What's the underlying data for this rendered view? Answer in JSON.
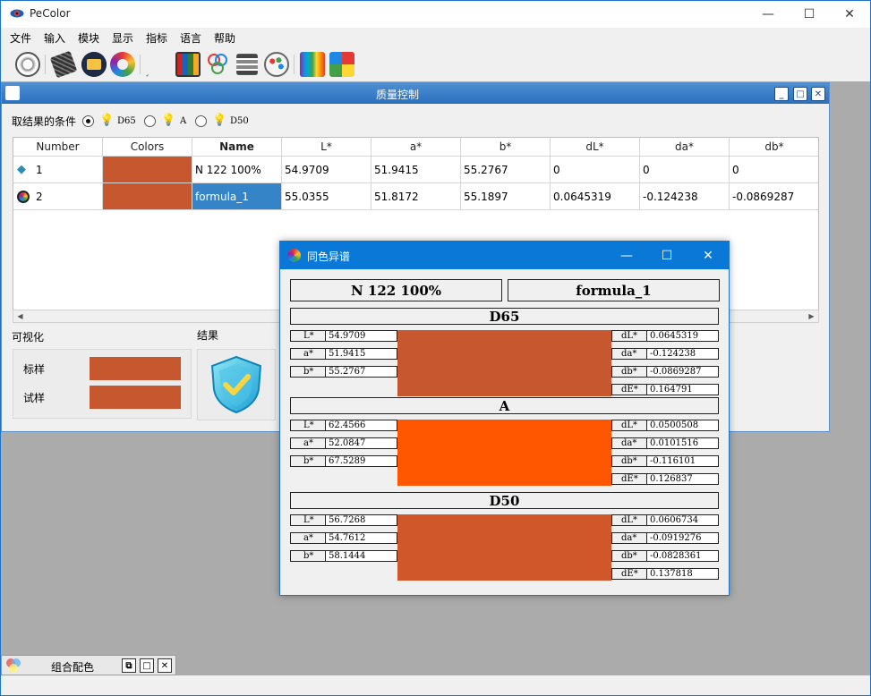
{
  "app": {
    "title": "PeColor"
  },
  "menu": [
    "文件",
    "输入",
    "模块",
    "显示",
    "指标",
    "语言",
    "帮助"
  ],
  "toolbar_icons": [
    "settings-gear-icon",
    "ruler-icon",
    "folder-icon",
    "color-ring-icon",
    "fan-deck-icon",
    "swatch-grid-icon",
    "rgb-circles-icon",
    "lab-report-icon",
    "palette-icon",
    "spectrum-icon",
    "color-square-icon"
  ],
  "qc": {
    "title": "质量控制",
    "condition_label": "取结果的条件",
    "illuminants": [
      {
        "label": "D65",
        "selected": true
      },
      {
        "label": "A",
        "selected": false
      },
      {
        "label": "D50",
        "selected": false
      }
    ],
    "columns": [
      "Number",
      "Colors",
      "Name",
      "L*",
      "a*",
      "b*",
      "dL*",
      "da*",
      "db*"
    ],
    "rows": [
      {
        "icon": "diamond-icon",
        "number": "1",
        "name": "N 122 100%",
        "L": "54.9709",
        "a": "51.9415",
        "b": "55.2767",
        "dL": "0",
        "da": "0",
        "db": "0",
        "color": "#c6572e"
      },
      {
        "icon": "sample-ball-icon",
        "number": "2",
        "name": "formula_1",
        "L": "55.0355",
        "a": "51.8172",
        "b": "55.1897",
        "dL": "0.0645319",
        "da": "-0.124238",
        "db": "-0.0869287",
        "color": "#c6572e"
      }
    ],
    "vis_title": "可视化",
    "vis_std": "标样",
    "vis_trial": "试样",
    "result_title": "结果"
  },
  "dialog": {
    "title": "同色异谱",
    "std_name": "N 122 100%",
    "trial_name": "formula_1",
    "sections": [
      {
        "name": "D65",
        "color": "#c6572e",
        "left": [
          [
            "L*",
            "54.9709"
          ],
          [
            "a*",
            "51.9415"
          ],
          [
            "b*",
            "55.2767"
          ]
        ],
        "right": [
          [
            "dL*",
            "0.0645319"
          ],
          [
            "da*",
            "-0.124238"
          ],
          [
            "db*",
            "-0.0869287"
          ],
          [
            "dE*",
            "0.164791"
          ]
        ]
      },
      {
        "name": "A",
        "color": "#ff5600",
        "left": [
          [
            "L*",
            "62.4566"
          ],
          [
            "a*",
            "52.0847"
          ],
          [
            "b*",
            "67.5289"
          ]
        ],
        "right": [
          [
            "dL*",
            "0.0500508"
          ],
          [
            "da*",
            "0.0101516"
          ],
          [
            "db*",
            "-0.116101"
          ],
          [
            "dE*",
            "0.126837"
          ]
        ]
      },
      {
        "name": "D50",
        "color": "#d05729",
        "left": [
          [
            "L*",
            "56.7268"
          ],
          [
            "a*",
            "54.7612"
          ],
          [
            "b*",
            "58.1444"
          ]
        ],
        "right": [
          [
            "dL*",
            "0.0606734"
          ],
          [
            "da*",
            "-0.0919276"
          ],
          [
            "db*",
            "-0.0828361"
          ],
          [
            "dE*",
            "0.137818"
          ]
        ]
      }
    ]
  },
  "minimized": {
    "title": "组合配色"
  }
}
